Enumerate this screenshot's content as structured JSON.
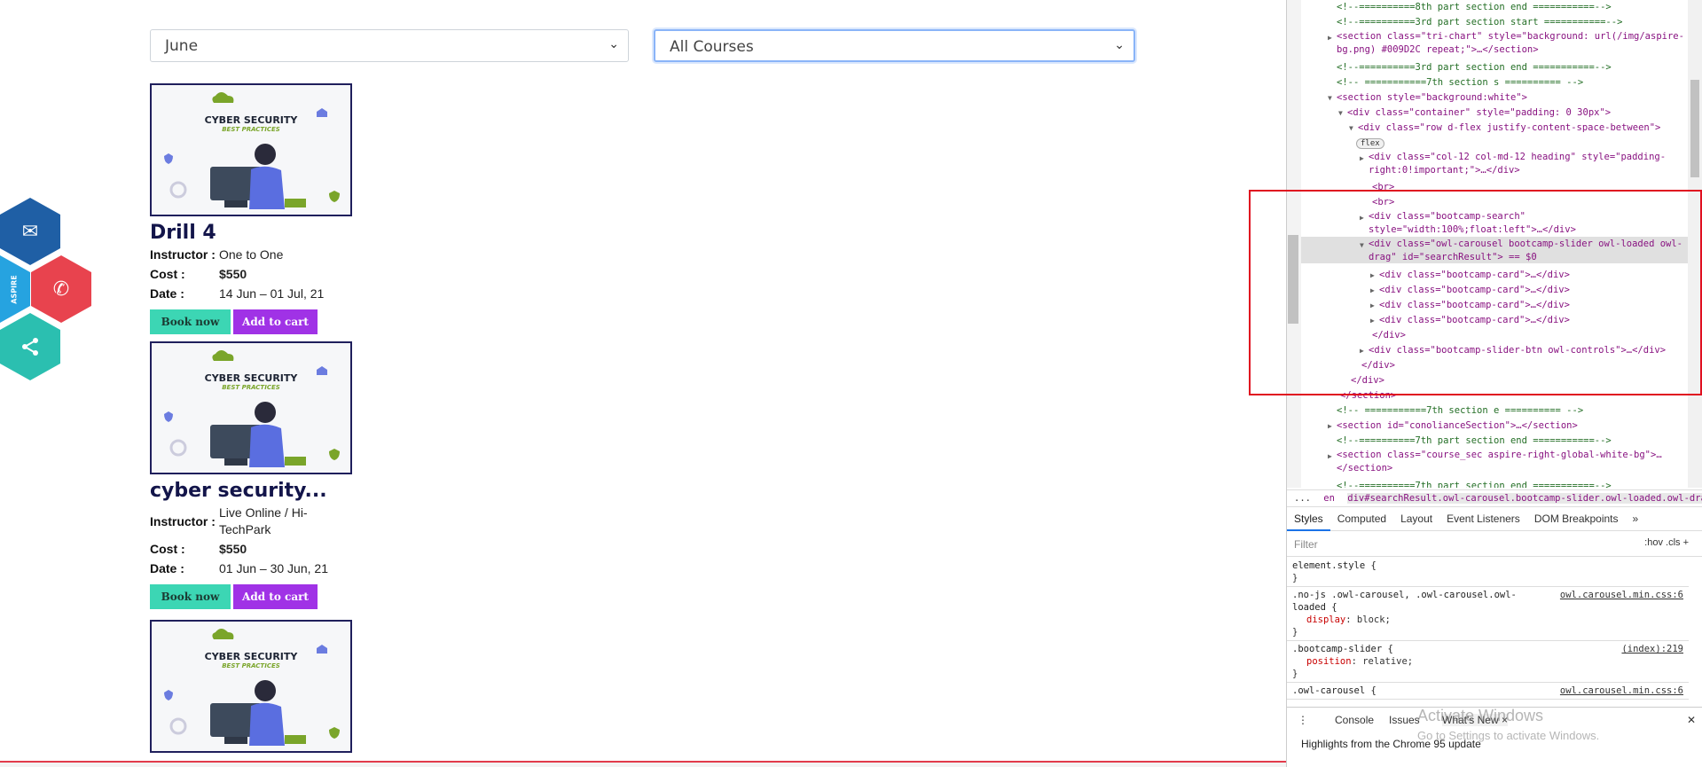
{
  "filters": {
    "month": "June",
    "course": "All Courses"
  },
  "cards": [
    {
      "image_title": "CYBER SECURITY",
      "image_subtitle": "BEST PRACTICES",
      "title": "Drill 4",
      "instructor_label": "Instructor :",
      "instructor": "One to One",
      "cost_label": "Cost :",
      "cost": "$550",
      "date_label": "Date :",
      "date": "14 Jun – 01 Jul, 21",
      "book_label": "Book now",
      "cart_label": "Add to cart"
    },
    {
      "image_title": "CYBER SECURITY",
      "image_subtitle": "BEST PRACTICES",
      "title": "cyber security...",
      "instructor_label": "Instructor :",
      "instructor": "Live Online / Hi-TechPark",
      "cost_label": "Cost :",
      "cost": "$550",
      "date_label": "Date :",
      "date": "01 Jun – 30 Jun, 21",
      "book_label": "Book now",
      "cart_label": "Add to cart"
    },
    {
      "image_title": "CYBER SECURITY",
      "image_subtitle": "BEST PRACTICES"
    }
  ],
  "social": {
    "aspire_label": "ASPIRE",
    "icons": [
      "mail-icon",
      "phone-icon",
      "share-icon"
    ],
    "colors": [
      "#1f5fa5",
      "#e8434e",
      "#2bbfb0",
      "#26a3e0"
    ]
  },
  "devtools": {
    "lines": [
      "<!--==========8th part section end ===========-->",
      "<!--==========3rd part section start ===========-->",
      "<section class=\"tri-chart\" style=\"background: url(/img/aspire-bg.png) #009D2C repeat;\">…</section>",
      "<!--==========3rd part section end ===========-->",
      "<!-- ===========7th section s ========== -->",
      "<section style=\"background:white\">",
      "<div class=\"container\" style=\"padding: 0 30px\">",
      "<div class=\"row d-flex justify-content-space-between\">",
      "flex",
      "<div class=\"col-12 col-md-12 heading\" style=\"padding-right:0!important;\">…</div>",
      "<br>",
      "<br>",
      "<div class=\"bootcamp-search\" style=\"width:100%;float:left\">…</div>",
      "<div class=\"owl-carousel bootcamp-slider owl-loaded owl-drag\" id=\"searchResult\"> == $0",
      "<div class=\"bootcamp-card\">…</div>",
      "<div class=\"bootcamp-card\">…</div>",
      "<div class=\"bootcamp-card\">…</div>",
      "<div class=\"bootcamp-card\">…</div>",
      "</div>",
      "<div class=\"bootcamp-slider-btn owl-controls\">…</div>",
      "</div>",
      "</div>",
      "</section>",
      "<!-- ===========7th section e ========== -->",
      "<section id=\"conolianceSection\">…</section>",
      "<!--==========7th part section end ===========-->",
      "<section class=\"course_sec aspire-right-global-white-bg\">…</section>",
      "<!--==========7th part section end ===========-->"
    ],
    "breadcrumb_dots": "...",
    "breadcrumb_en": "en",
    "breadcrumb": "div#searchResult.owl-carousel.bootcamp-slider.owl-loaded.owl-drag",
    "tabs": [
      "Styles",
      "Computed",
      "Layout",
      "Event Listeners",
      "DOM Breakpoints",
      "»"
    ],
    "filter_placeholder": "Filter",
    "filter_controls": ":hov  .cls  +",
    "rules": [
      {
        "selector": "element.style {",
        "source": "",
        "props": [],
        "close": "}"
      },
      {
        "selector": ".no-js .owl-carousel, .owl-carousel.owl-loaded {",
        "source": "owl.carousel.min.css:6",
        "props": [
          {
            "name": "display",
            "value": "block;"
          }
        ],
        "close": "}"
      },
      {
        "selector": ".bootcamp-slider {",
        "source": "(index):219",
        "props": [
          {
            "name": "position",
            "value": "relative;"
          }
        ],
        "close": "}"
      },
      {
        "selector": ".owl-carousel {",
        "source": "owl.carousel.min.css:6",
        "props": [],
        "close": ""
      }
    ],
    "console_tabs": [
      "Console",
      "Issues",
      "What's New ×"
    ],
    "highlights": "Highlights from the Chrome 95 update",
    "watermark_title": "Activate Windows",
    "watermark_sub": "Go to Settings to activate Windows."
  }
}
